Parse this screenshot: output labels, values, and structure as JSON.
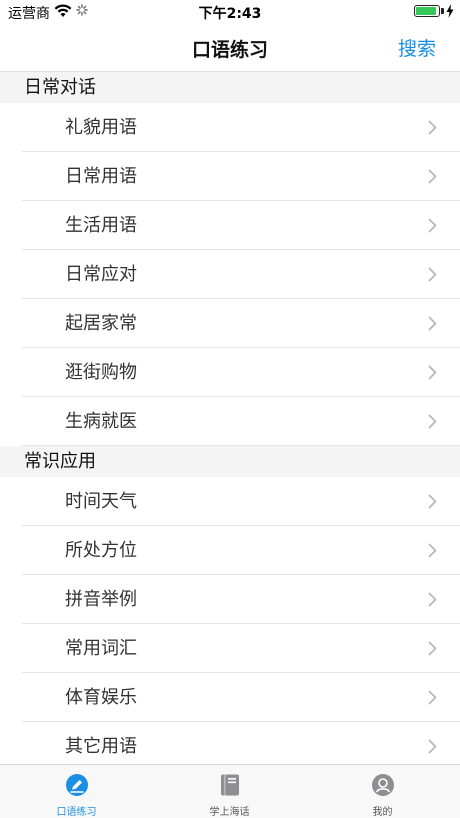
{
  "status_bar": {
    "carrier": "运营商",
    "time": "下午2:43",
    "battery_level": 0.9
  },
  "nav": {
    "title": "口语练习",
    "search_label": "搜索"
  },
  "sections": [
    {
      "title": "日常对话",
      "items": [
        {
          "label": "礼貌用语"
        },
        {
          "label": "日常用语"
        },
        {
          "label": "生活用语"
        },
        {
          "label": "日常应对"
        },
        {
          "label": "起居家常"
        },
        {
          "label": "逛街购物"
        },
        {
          "label": "生病就医"
        }
      ]
    },
    {
      "title": "常识应用",
      "items": [
        {
          "label": "时间天气"
        },
        {
          "label": "所处方位"
        },
        {
          "label": "拼音举例"
        },
        {
          "label": "常用词汇"
        },
        {
          "label": "体育娱乐"
        },
        {
          "label": "其它用语"
        }
      ]
    }
  ],
  "tabs": [
    {
      "label": "口语练习",
      "icon": "pencil-icon",
      "active": true
    },
    {
      "label": "学上海话",
      "icon": "book-icon",
      "active": false
    },
    {
      "label": "我的",
      "icon": "profile-icon",
      "active": false
    }
  ],
  "colors": {
    "accent": "#1a8fe3",
    "battery": "#34c759",
    "inactive_icon": "#8e8e93"
  }
}
